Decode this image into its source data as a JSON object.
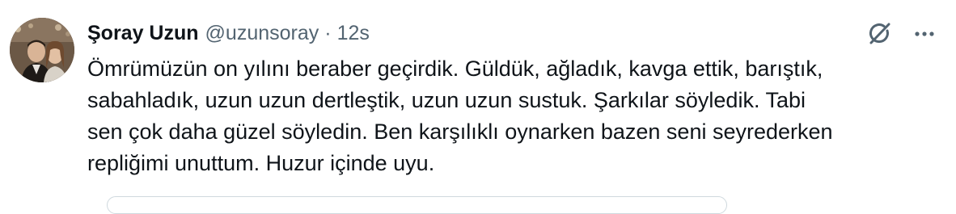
{
  "tweet": {
    "display_name": "Şoray Uzun",
    "handle": "@uzunsoray",
    "separator": "·",
    "timestamp": "12s",
    "text_lines": [
      "Ömrümüzün on yılını beraber geçirdik. Güldük, ağladık, kavga ettik, barıştık,",
      "sabahladık, uzun uzun dertleştik, uzun uzun sustuk. Şarkılar söyledik. Tabi",
      "sen çok daha güzel söyledin. Ben karşılıklı oynarken bazen seni seyrederken",
      "repliğimi unuttum. Huzur içinde uyu."
    ]
  },
  "icons": {
    "grok": "grok-icon",
    "more": "more-options-icon"
  },
  "colors": {
    "text_primary": "#0f1419",
    "text_secondary": "#536471",
    "border": "#cfd9de"
  }
}
